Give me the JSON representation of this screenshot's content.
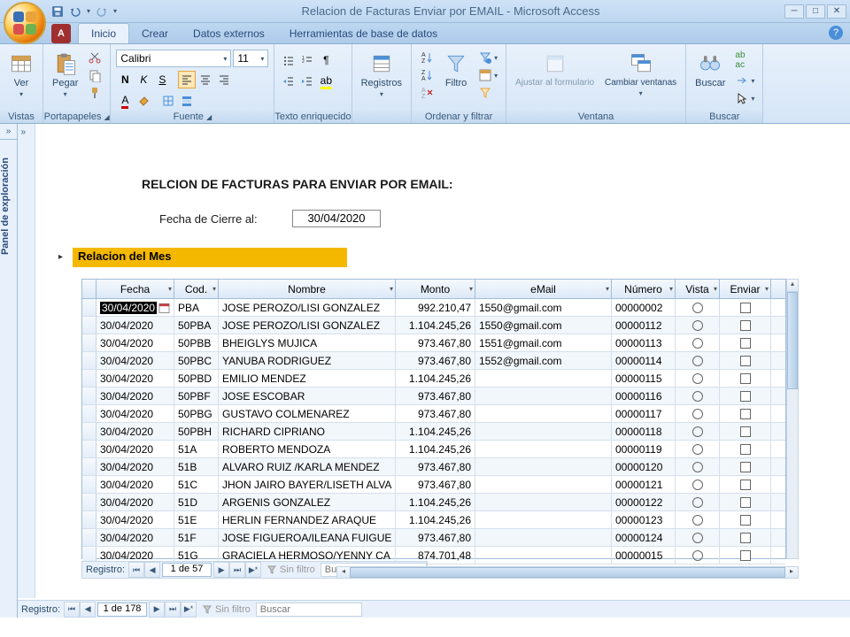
{
  "title": "Relacion de Facturas Enviar por EMAIL - Microsoft Access",
  "tabs": {
    "home": "Inicio",
    "create": "Crear",
    "external": "Datos externos",
    "dbtools": "Herramientas de base de datos"
  },
  "ribbon": {
    "views": {
      "btn": "Ver",
      "label": "Vistas"
    },
    "clipboard": {
      "btn": "Pegar",
      "label": "Portapapeles"
    },
    "font": {
      "name": "Calibri",
      "size": "11",
      "label": "Fuente"
    },
    "richtext": {
      "label": "Texto enriquecido"
    },
    "records": {
      "btn": "Registros",
      "label": ""
    },
    "sortfilter": {
      "btn": "Filtro",
      "label": "Ordenar y filtrar"
    },
    "window": {
      "btn1": "Ajustar al formulario",
      "btn2": "Cambiar ventanas",
      "label": "Ventana"
    },
    "find": {
      "btn": "Buscar",
      "label": "Buscar"
    }
  },
  "sidepanel": "Panel de exploración",
  "report": {
    "title": "RELCION DE FACTURAS PARA ENVIAR POR EMAIL:",
    "date_label": "Fecha de Cierre al:",
    "date_value": "30/04/2020",
    "sub_header": "Relacion del Mes"
  },
  "columns": {
    "fecha": "Fecha",
    "cod": "Cod.",
    "nombre": "Nombre",
    "monto": "Monto",
    "email": "eMail",
    "numero": "Número",
    "vista": "Vista",
    "enviar": "Enviar"
  },
  "rows": [
    {
      "fecha": "30/04/2020",
      "cod": "PBA",
      "nombre": "JOSE PEROZO/LISI GONZALEZ",
      "monto": "992.210,47",
      "email": "1550@gmail.com",
      "num": "00000002",
      "sel": true
    },
    {
      "fecha": "30/04/2020",
      "cod": "50PBA",
      "nombre": "JOSE PEROZO/LISI GONZALEZ",
      "monto": "1.104.245,26",
      "email": "1550@gmail.com",
      "num": "00000112"
    },
    {
      "fecha": "30/04/2020",
      "cod": "50PBB",
      "nombre": "BHEIGLYS MUJICA",
      "monto": "973.467,80",
      "email": "1551@gmail.com",
      "num": "00000113"
    },
    {
      "fecha": "30/04/2020",
      "cod": "50PBC",
      "nombre": "YANUBA RODRIGUEZ",
      "monto": "973.467,80",
      "email": "1552@gmail.com",
      "num": "00000114"
    },
    {
      "fecha": "30/04/2020",
      "cod": "50PBD",
      "nombre": "EMILIO MENDEZ",
      "monto": "1.104.245,26",
      "email": "",
      "num": "00000115"
    },
    {
      "fecha": "30/04/2020",
      "cod": "50PBF",
      "nombre": "JOSE ESCOBAR",
      "monto": "973.467,80",
      "email": "",
      "num": "00000116"
    },
    {
      "fecha": "30/04/2020",
      "cod": "50PBG",
      "nombre": "GUSTAVO COLMENAREZ",
      "monto": "973.467,80",
      "email": "",
      "num": "00000117"
    },
    {
      "fecha": "30/04/2020",
      "cod": "50PBH",
      "nombre": "RICHARD CIPRIANO",
      "monto": "1.104.245,26",
      "email": "",
      "num": "00000118"
    },
    {
      "fecha": "30/04/2020",
      "cod": "51A",
      "nombre": "ROBERTO MENDOZA",
      "monto": "1.104.245,26",
      "email": "",
      "num": "00000119"
    },
    {
      "fecha": "30/04/2020",
      "cod": "51B",
      "nombre": "ALVARO RUIZ /KARLA MENDEZ",
      "monto": "973.467,80",
      "email": "",
      "num": "00000120"
    },
    {
      "fecha": "30/04/2020",
      "cod": "51C",
      "nombre": "JHON JAIRO BAYER/LISETH ALVA",
      "monto": "973.467,80",
      "email": "",
      "num": "00000121"
    },
    {
      "fecha": "30/04/2020",
      "cod": "51D",
      "nombre": "ARGENIS GONZALEZ",
      "monto": "1.104.245,26",
      "email": "",
      "num": "00000122"
    },
    {
      "fecha": "30/04/2020",
      "cod": "51E",
      "nombre": "HERLIN FERNANDEZ ARAQUE",
      "monto": "1.104.245,26",
      "email": "",
      "num": "00000123"
    },
    {
      "fecha": "30/04/2020",
      "cod": "51F",
      "nombre": "JOSE FIGUEROA/ILEANA FUIGUE",
      "monto": "973.467,80",
      "email": "",
      "num": "00000124"
    },
    {
      "fecha": "30/04/2020",
      "cod": "51G",
      "nombre": "GRACIELA HERMOSO/YENNY CA",
      "monto": "874.701,48",
      "email": "",
      "num": "00000015"
    }
  ],
  "recnav": {
    "label": "Registro:",
    "pos_inner": "1 de 57",
    "pos_outer": "1 de 178",
    "nofilter": "Sin filtro",
    "search": "Buscar"
  }
}
